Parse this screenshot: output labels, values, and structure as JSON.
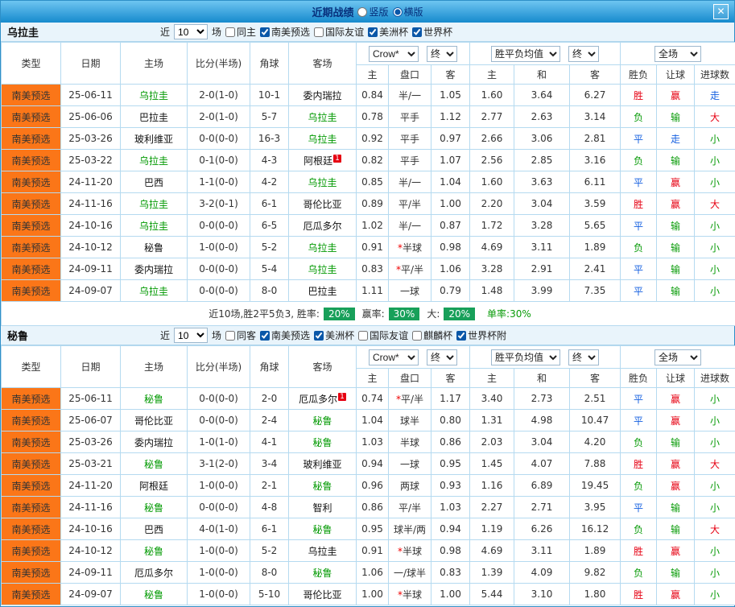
{
  "header": {
    "title": "近期战绩",
    "radios": [
      {
        "label": "竖版",
        "selected": false
      },
      {
        "label": "横版",
        "selected": true
      }
    ],
    "close_label": "✕"
  },
  "colors": {
    "accent_orange": "#fb7618",
    "win_red": "#e60012",
    "lose_green": "#089b08",
    "draw_blue": "#1560e0",
    "team_green": "#009900",
    "score_red": "#ff0000",
    "badge_green": "#18a05a"
  },
  "sections": [
    {
      "team": "乌拉圭",
      "filter": {
        "near_label": "近",
        "count": "10",
        "games_label": "场",
        "checkboxes": [
          {
            "label": "同主",
            "checked": false
          },
          {
            "label": "南美预选",
            "checked": true
          },
          {
            "label": "国际友谊",
            "checked": false
          },
          {
            "label": "美洲杯",
            "checked": true
          },
          {
            "label": "世界杯",
            "checked": true
          }
        ]
      },
      "dropdowns": {
        "odds_source": "Crow*",
        "odds_time": "终",
        "eu_source": "胜平负均值",
        "eu_time": "终",
        "scope": "全场"
      },
      "columns": [
        "类型",
        "日期",
        "主场",
        "比分(半场)",
        "角球",
        "客场",
        "主",
        "盘口",
        "客",
        "主",
        "和",
        "客",
        "胜负",
        "让球",
        "进球数"
      ],
      "rows": [
        {
          "type": "南美预选",
          "date": "25-06-11",
          "home": "乌拉圭",
          "home_focus": true,
          "home_badge": "",
          "score": "2-0(1-0)",
          "corner": "10-1",
          "away": "委内瑞拉",
          "away_focus": false,
          "away_badge": "",
          "asia": [
            "0.84",
            "半/一",
            "1.05"
          ],
          "europe": [
            "1.60",
            "3.64",
            "6.27"
          ],
          "result": [
            "胜",
            "r"
          ],
          "let": [
            "赢",
            "r"
          ],
          "goals": [
            "走",
            "b"
          ]
        },
        {
          "type": "南美预选",
          "date": "25-06-06",
          "home": "巴拉圭",
          "home_focus": false,
          "home_badge": "",
          "score": "2-0(1-0)",
          "corner": "5-7",
          "away": "乌拉圭",
          "away_focus": true,
          "away_badge": "",
          "asia": [
            "0.78",
            "平手",
            "1.12"
          ],
          "europe": [
            "2.77",
            "2.63",
            "3.14"
          ],
          "result": [
            "负",
            "g"
          ],
          "let": [
            "输",
            "g"
          ],
          "goals": [
            "大",
            "r"
          ]
        },
        {
          "type": "南美预选",
          "date": "25-03-26",
          "home": "玻利维亚",
          "home_focus": false,
          "home_badge": "",
          "score": "0-0(0-0)",
          "corner": "16-3",
          "away": "乌拉圭",
          "away_focus": true,
          "away_badge": "",
          "asia": [
            "0.92",
            "平手",
            "0.97"
          ],
          "europe": [
            "2.66",
            "3.06",
            "2.81"
          ],
          "result": [
            "平",
            "b"
          ],
          "let": [
            "走",
            "b"
          ],
          "goals": [
            "小",
            "g"
          ]
        },
        {
          "type": "南美预选",
          "date": "25-03-22",
          "home": "乌拉圭",
          "home_focus": true,
          "home_badge": "",
          "score": "0-1(0-0)",
          "corner": "4-3",
          "away": "阿根廷",
          "away_focus": false,
          "away_badge": "1",
          "asia": [
            "0.82",
            "平手",
            "1.07"
          ],
          "europe": [
            "2.56",
            "2.85",
            "3.16"
          ],
          "result": [
            "负",
            "g"
          ],
          "let": [
            "输",
            "g"
          ],
          "goals": [
            "小",
            "g"
          ]
        },
        {
          "type": "南美预选",
          "date": "24-11-20",
          "home": "巴西",
          "home_focus": false,
          "home_badge": "",
          "score": "1-1(0-0)",
          "corner": "4-2",
          "away": "乌拉圭",
          "away_focus": true,
          "away_badge": "",
          "asia": [
            "0.85",
            "半/一",
            "1.04"
          ],
          "europe": [
            "1.60",
            "3.63",
            "6.11"
          ],
          "result": [
            "平",
            "b"
          ],
          "let": [
            "赢",
            "r"
          ],
          "goals": [
            "小",
            "g"
          ]
        },
        {
          "type": "南美预选",
          "date": "24-11-16",
          "home": "乌拉圭",
          "home_focus": true,
          "home_badge": "",
          "score": "3-2(0-1)",
          "corner": "6-1",
          "away": "哥伦比亚",
          "away_focus": false,
          "away_badge": "",
          "asia": [
            "0.89",
            "平/半",
            "1.00"
          ],
          "europe": [
            "2.20",
            "3.04",
            "3.59"
          ],
          "result": [
            "胜",
            "r"
          ],
          "let": [
            "赢",
            "r"
          ],
          "goals": [
            "大",
            "r"
          ]
        },
        {
          "type": "南美预选",
          "date": "24-10-16",
          "home": "乌拉圭",
          "home_focus": true,
          "home_badge": "",
          "score": "0-0(0-0)",
          "corner": "6-5",
          "away": "厄瓜多尔",
          "away_focus": false,
          "away_badge": "",
          "asia": [
            "1.02",
            "半/一",
            "0.87"
          ],
          "europe": [
            "1.72",
            "3.28",
            "5.65"
          ],
          "result": [
            "平",
            "b"
          ],
          "let": [
            "输",
            "g"
          ],
          "goals": [
            "小",
            "g"
          ]
        },
        {
          "type": "南美预选",
          "date": "24-10-12",
          "home": "秘鲁",
          "home_focus": false,
          "home_badge": "",
          "score": "1-0(0-0)",
          "corner": "5-2",
          "away": "乌拉圭",
          "away_focus": true,
          "away_badge": "",
          "asia": [
            "0.91",
            "*半球",
            "0.98"
          ],
          "europe": [
            "4.69",
            "3.11",
            "1.89"
          ],
          "result": [
            "负",
            "g"
          ],
          "let": [
            "输",
            "g"
          ],
          "goals": [
            "小",
            "g"
          ]
        },
        {
          "type": "南美预选",
          "date": "24-09-11",
          "home": "委内瑞拉",
          "home_focus": false,
          "home_badge": "",
          "score": "0-0(0-0)",
          "corner": "5-4",
          "away": "乌拉圭",
          "away_focus": true,
          "away_badge": "",
          "asia": [
            "0.83",
            "*平/半",
            "1.06"
          ],
          "europe": [
            "3.28",
            "2.91",
            "2.41"
          ],
          "result": [
            "平",
            "b"
          ],
          "let": [
            "输",
            "g"
          ],
          "goals": [
            "小",
            "g"
          ]
        },
        {
          "type": "南美预选",
          "date": "24-09-07",
          "home": "乌拉圭",
          "home_focus": true,
          "home_badge": "",
          "score": "0-0(0-0)",
          "corner": "8-0",
          "away": "巴拉圭",
          "away_focus": false,
          "away_badge": "",
          "asia": [
            "1.11",
            "一球",
            "0.79"
          ],
          "europe": [
            "1.48",
            "3.99",
            "7.35"
          ],
          "result": [
            "平",
            "b"
          ],
          "let": [
            "输",
            "g"
          ],
          "goals": [
            "小",
            "g"
          ]
        }
      ],
      "summary": {
        "lead": "近10场,胜2平5负3, 胜率:",
        "win_badge": "20%",
        "mid1": "赢率:",
        "asia_badge": "30%",
        "mid2": "大:",
        "big_badge": "20%",
        "tail": "单率:30%"
      }
    },
    {
      "team": "秘鲁",
      "filter": {
        "near_label": "近",
        "count": "10",
        "games_label": "场",
        "checkboxes": [
          {
            "label": "同客",
            "checked": false
          },
          {
            "label": "南美预选",
            "checked": true
          },
          {
            "label": "美洲杯",
            "checked": true
          },
          {
            "label": "国际友谊",
            "checked": false
          },
          {
            "label": "麒麟杯",
            "checked": false
          },
          {
            "label": "世界杯附",
            "checked": true
          }
        ]
      },
      "dropdowns": {
        "odds_source": "Crow*",
        "odds_time": "终",
        "eu_source": "胜平负均值",
        "eu_time": "终",
        "scope": "全场"
      },
      "columns": [
        "类型",
        "日期",
        "主场",
        "比分(半场)",
        "角球",
        "客场",
        "主",
        "盘口",
        "客",
        "主",
        "和",
        "客",
        "胜负",
        "让球",
        "进球数"
      ],
      "rows": [
        {
          "type": "南美预选",
          "date": "25-06-11",
          "home": "秘鲁",
          "home_focus": true,
          "home_badge": "",
          "score": "0-0(0-0)",
          "corner": "2-0",
          "away": "厄瓜多尔",
          "away_focus": false,
          "away_badge": "1",
          "asia": [
            "0.74",
            "*平/半",
            "1.17"
          ],
          "europe": [
            "3.40",
            "2.73",
            "2.51"
          ],
          "result": [
            "平",
            "b"
          ],
          "let": [
            "赢",
            "r"
          ],
          "goals": [
            "小",
            "g"
          ]
        },
        {
          "type": "南美预选",
          "date": "25-06-07",
          "home": "哥伦比亚",
          "home_focus": false,
          "home_badge": "",
          "score": "0-0(0-0)",
          "corner": "2-4",
          "away": "秘鲁",
          "away_focus": true,
          "away_badge": "",
          "asia": [
            "1.04",
            "球半",
            "0.80"
          ],
          "europe": [
            "1.31",
            "4.98",
            "10.47"
          ],
          "result": [
            "平",
            "b"
          ],
          "let": [
            "赢",
            "r"
          ],
          "goals": [
            "小",
            "g"
          ]
        },
        {
          "type": "南美预选",
          "date": "25-03-26",
          "home": "委内瑞拉",
          "home_focus": false,
          "home_badge": "",
          "score": "1-0(1-0)",
          "corner": "4-1",
          "away": "秘鲁",
          "away_focus": true,
          "away_badge": "",
          "asia": [
            "1.03",
            "半球",
            "0.86"
          ],
          "europe": [
            "2.03",
            "3.04",
            "4.20"
          ],
          "result": [
            "负",
            "g"
          ],
          "let": [
            "输",
            "g"
          ],
          "goals": [
            "小",
            "g"
          ]
        },
        {
          "type": "南美预选",
          "date": "25-03-21",
          "home": "秘鲁",
          "home_focus": true,
          "home_badge": "",
          "score": "3-1(2-0)",
          "corner": "3-4",
          "away": "玻利维亚",
          "away_focus": false,
          "away_badge": "",
          "asia": [
            "0.94",
            "一球",
            "0.95"
          ],
          "europe": [
            "1.45",
            "4.07",
            "7.88"
          ],
          "result": [
            "胜",
            "r"
          ],
          "let": [
            "赢",
            "r"
          ],
          "goals": [
            "大",
            "r"
          ]
        },
        {
          "type": "南美预选",
          "date": "24-11-20",
          "home": "阿根廷",
          "home_focus": false,
          "home_badge": "",
          "score": "1-0(0-0)",
          "corner": "2-1",
          "away": "秘鲁",
          "away_focus": true,
          "away_badge": "",
          "asia": [
            "0.96",
            "两球",
            "0.93"
          ],
          "europe": [
            "1.16",
            "6.89",
            "19.45"
          ],
          "result": [
            "负",
            "g"
          ],
          "let": [
            "赢",
            "r"
          ],
          "goals": [
            "小",
            "g"
          ]
        },
        {
          "type": "南美预选",
          "date": "24-11-16",
          "home": "秘鲁",
          "home_focus": true,
          "home_badge": "",
          "score": "0-0(0-0)",
          "corner": "4-8",
          "away": "智利",
          "away_focus": false,
          "away_badge": "",
          "asia": [
            "0.86",
            "平/半",
            "1.03"
          ],
          "europe": [
            "2.27",
            "2.71",
            "3.95"
          ],
          "result": [
            "平",
            "b"
          ],
          "let": [
            "输",
            "g"
          ],
          "goals": [
            "小",
            "g"
          ]
        },
        {
          "type": "南美预选",
          "date": "24-10-16",
          "home": "巴西",
          "home_focus": false,
          "home_badge": "",
          "score": "4-0(1-0)",
          "corner": "6-1",
          "away": "秘鲁",
          "away_focus": true,
          "away_badge": "",
          "asia": [
            "0.95",
            "球半/两",
            "0.94"
          ],
          "europe": [
            "1.19",
            "6.26",
            "16.12"
          ],
          "result": [
            "负",
            "g"
          ],
          "let": [
            "输",
            "g"
          ],
          "goals": [
            "大",
            "r"
          ]
        },
        {
          "type": "南美预选",
          "date": "24-10-12",
          "home": "秘鲁",
          "home_focus": true,
          "home_badge": "",
          "score": "1-0(0-0)",
          "corner": "5-2",
          "away": "乌拉圭",
          "away_focus": false,
          "away_badge": "",
          "asia": [
            "0.91",
            "*半球",
            "0.98"
          ],
          "europe": [
            "4.69",
            "3.11",
            "1.89"
          ],
          "result": [
            "胜",
            "r"
          ],
          "let": [
            "赢",
            "r"
          ],
          "goals": [
            "小",
            "g"
          ]
        },
        {
          "type": "南美预选",
          "date": "24-09-11",
          "home": "厄瓜多尔",
          "home_focus": false,
          "home_badge": "",
          "score": "1-0(0-0)",
          "corner": "8-0",
          "away": "秘鲁",
          "away_focus": true,
          "away_badge": "",
          "asia": [
            "1.06",
            "一/球半",
            "0.83"
          ],
          "europe": [
            "1.39",
            "4.09",
            "9.82"
          ],
          "result": [
            "负",
            "g"
          ],
          "let": [
            "输",
            "g"
          ],
          "goals": [
            "小",
            "g"
          ]
        },
        {
          "type": "南美预选",
          "date": "24-09-07",
          "home": "秘鲁",
          "home_focus": true,
          "home_badge": "",
          "score": "1-0(0-0)",
          "corner": "5-10",
          "away": "哥伦比亚",
          "away_focus": false,
          "away_badge": "",
          "asia": [
            "1.00",
            "*半球",
            "1.00"
          ],
          "europe": [
            "5.44",
            "3.10",
            "1.80"
          ],
          "result": [
            "胜",
            "r"
          ],
          "let": [
            "赢",
            "r"
          ],
          "goals": [
            "小",
            "g"
          ]
        }
      ],
      "summary": null
    }
  ]
}
